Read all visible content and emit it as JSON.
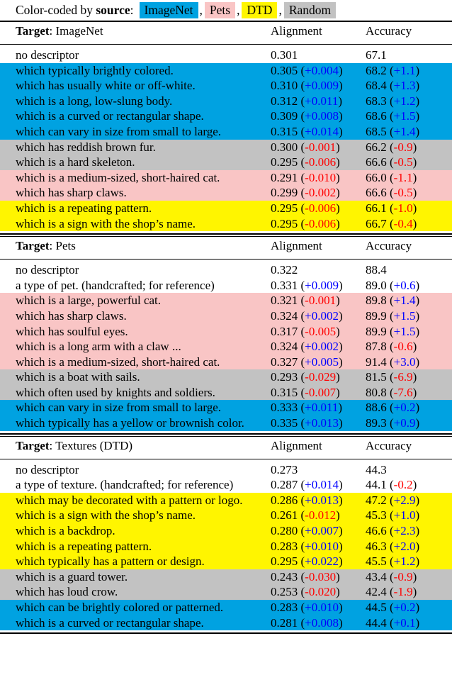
{
  "legend": {
    "prefix_before_bold": "Color-coded by ",
    "bold_word": "source",
    "colon": ":",
    "chips": [
      {
        "label": "ImageNet",
        "color": "#00A2E1"
      },
      {
        "label": "Pets",
        "color": "#F9C5C5"
      },
      {
        "label": "DTD",
        "color": "#FFF500"
      },
      {
        "label": "Random",
        "color": "#C2C2C2"
      }
    ],
    "separator": ","
  },
  "colors": {
    "imagenet": "#00A2E1",
    "pets": "#F9C5C5",
    "dtd": "#FFF500",
    "random": "#C2C2C2",
    "delta_positive": "#0000FF",
    "delta_negative": "#FF0000"
  },
  "columns": {
    "descriptor": "",
    "alignment": "Alignment",
    "accuracy": "Accuracy"
  },
  "sections": [
    {
      "target_label": "Target",
      "target_name": "ImageNet",
      "rows": [
        {
          "desc": "no descriptor",
          "align": "0.301",
          "align_delta": "",
          "align_sign": "",
          "acc": "67.1",
          "acc_delta": "",
          "acc_sign": "",
          "source": "none"
        },
        {
          "desc": "which typically brightly colored.",
          "align": "0.305",
          "align_delta": "+0.004",
          "align_sign": "pos",
          "acc": "68.2",
          "acc_delta": "+1.1",
          "acc_sign": "pos",
          "source": "imagenet"
        },
        {
          "desc": "which has usually white or off-white.",
          "align": "0.310",
          "align_delta": "+0.009",
          "align_sign": "pos",
          "acc": "68.4",
          "acc_delta": "+1.3",
          "acc_sign": "pos",
          "source": "imagenet"
        },
        {
          "desc": "which is a long, low-slung body.",
          "align": "0.312",
          "align_delta": "+0.011",
          "align_sign": "pos",
          "acc": "68.3",
          "acc_delta": "+1.2",
          "acc_sign": "pos",
          "source": "imagenet"
        },
        {
          "desc": "which is a curved or rectangular shape.",
          "align": "0.309",
          "align_delta": "+0.008",
          "align_sign": "pos",
          "acc": "68.6",
          "acc_delta": "+1.5",
          "acc_sign": "pos",
          "source": "imagenet"
        },
        {
          "desc": "which can vary in size from small to large.",
          "align": "0.315",
          "align_delta": "+0.014",
          "align_sign": "pos",
          "acc": "68.5",
          "acc_delta": "+1.4",
          "acc_sign": "pos",
          "source": "imagenet"
        },
        {
          "desc": "which has reddish brown fur.",
          "align": "0.300",
          "align_delta": "-0.001",
          "align_sign": "neg",
          "acc": "66.2",
          "acc_delta": "-0.9",
          "acc_sign": "neg",
          "source": "random"
        },
        {
          "desc": "which is a hard skeleton.",
          "align": "0.295",
          "align_delta": "-0.006",
          "align_sign": "neg",
          "acc": "66.6",
          "acc_delta": "-0.5",
          "acc_sign": "neg",
          "source": "random"
        },
        {
          "desc": "which is a medium-sized, short-haired cat.",
          "align": "0.291",
          "align_delta": "-0.010",
          "align_sign": "neg",
          "acc": "66.0",
          "acc_delta": "-1.1",
          "acc_sign": "neg",
          "source": "pets"
        },
        {
          "desc": "which has sharp claws.",
          "align": "0.299",
          "align_delta": "-0.002",
          "align_sign": "neg",
          "acc": "66.6",
          "acc_delta": "-0.5",
          "acc_sign": "neg",
          "source": "pets"
        },
        {
          "desc": "which is a repeating pattern.",
          "align": "0.295",
          "align_delta": "-0.006",
          "align_sign": "neg",
          "acc": "66.1",
          "acc_delta": "-1.0",
          "acc_sign": "neg",
          "source": "dtd"
        },
        {
          "desc": "which is a sign with the shop’s name.",
          "align": "0.295",
          "align_delta": "-0.006",
          "align_sign": "neg",
          "acc": "66.7",
          "acc_delta": "-0.4",
          "acc_sign": "neg",
          "source": "dtd"
        }
      ]
    },
    {
      "target_label": "Target",
      "target_name": "Pets",
      "rows": [
        {
          "desc": "no descriptor",
          "align": "0.322",
          "align_delta": "",
          "align_sign": "",
          "acc": "88.4",
          "acc_delta": "",
          "acc_sign": "",
          "source": "none"
        },
        {
          "desc": "a type of pet. (handcrafted; for reference)",
          "align": "0.331",
          "align_delta": "+0.009",
          "align_sign": "pos",
          "acc": "89.0",
          "acc_delta": "+0.6",
          "acc_sign": "pos",
          "source": "none"
        },
        {
          "desc": "which is a large, powerful cat.",
          "align": "0.321",
          "align_delta": "-0.001",
          "align_sign": "neg",
          "acc": "89.8",
          "acc_delta": "+1.4",
          "acc_sign": "pos",
          "source": "pets"
        },
        {
          "desc": "which has sharp claws.",
          "align": "0.324",
          "align_delta": "+0.002",
          "align_sign": "pos",
          "acc": "89.9",
          "acc_delta": "+1.5",
          "acc_sign": "pos",
          "source": "pets"
        },
        {
          "desc": "which has soulful eyes.",
          "align": "0.317",
          "align_delta": "-0.005",
          "align_sign": "neg",
          "acc": "89.9",
          "acc_delta": "+1.5",
          "acc_sign": "pos",
          "source": "pets"
        },
        {
          "desc": "which is a long arm with a claw ...",
          "align": "0.324",
          "align_delta": "+0.002",
          "align_sign": "pos",
          "acc": "87.8",
          "acc_delta": "-0.6",
          "acc_sign": "neg",
          "source": "pets"
        },
        {
          "desc": "which is a medium-sized, short-haired cat.",
          "align": "0.327",
          "align_delta": "+0.005",
          "align_sign": "pos",
          "acc": "91.4",
          "acc_delta": "+3.0",
          "acc_sign": "pos",
          "source": "pets"
        },
        {
          "desc": "which is a boat with sails.",
          "align": "0.293",
          "align_delta": "-0.029",
          "align_sign": "neg",
          "acc": "81.5",
          "acc_delta": "-6.9",
          "acc_sign": "neg",
          "source": "random"
        },
        {
          "desc": "which often used by knights and soldiers.",
          "align": "0.315",
          "align_delta": "-0.007",
          "align_sign": "neg",
          "acc": "80.8",
          "acc_delta": "-7.6",
          "acc_sign": "neg",
          "source": "random"
        },
        {
          "desc": "which can vary in size from small to large.",
          "align": "0.333",
          "align_delta": "+0.011",
          "align_sign": "pos",
          "acc": "88.6",
          "acc_delta": "+0.2",
          "acc_sign": "pos",
          "source": "imagenet"
        },
        {
          "desc": "which typically has a yellow or brownish color.",
          "align": "0.335",
          "align_delta": "+0.013",
          "align_sign": "pos",
          "acc": "89.3",
          "acc_delta": "+0.9",
          "acc_sign": "pos",
          "source": "imagenet"
        }
      ]
    },
    {
      "target_label": "Target",
      "target_name": "Textures (DTD)",
      "rows": [
        {
          "desc": "no descriptor",
          "align": "0.273",
          "align_delta": "",
          "align_sign": "",
          "acc": "44.3",
          "acc_delta": "",
          "acc_sign": "",
          "source": "none"
        },
        {
          "desc": "a type of texture. (handcrafted; for reference)",
          "align": "0.287",
          "align_delta": "+0.014",
          "align_sign": "pos",
          "acc": "44.1",
          "acc_delta": "-0.2",
          "acc_sign": "neg",
          "source": "none"
        },
        {
          "desc": "which may be decorated with a pattern or logo.",
          "align": "0.286",
          "align_delta": "+0.013",
          "align_sign": "pos",
          "acc": "47.2",
          "acc_delta": "+2.9",
          "acc_sign": "pos",
          "source": "dtd"
        },
        {
          "desc": "which is a sign with the shop’s name.",
          "align": "0.261",
          "align_delta": "-0.012",
          "align_sign": "neg",
          "acc": "45.3",
          "acc_delta": "+1.0",
          "acc_sign": "pos",
          "source": "dtd"
        },
        {
          "desc": "which is a backdrop.",
          "align": "0.280",
          "align_delta": "+0.007",
          "align_sign": "pos",
          "acc": "46.6",
          "acc_delta": "+2.3",
          "acc_sign": "pos",
          "source": "dtd"
        },
        {
          "desc": "which is a repeating pattern.",
          "align": "0.283",
          "align_delta": "+0.010",
          "align_sign": "pos",
          "acc": "46.3",
          "acc_delta": "+2.0",
          "acc_sign": "pos",
          "source": "dtd"
        },
        {
          "desc": "which typically has a pattern or design.",
          "align": "0.295",
          "align_delta": "+0.022",
          "align_sign": "pos",
          "acc": "45.5",
          "acc_delta": "+1.2",
          "acc_sign": "pos",
          "source": "dtd"
        },
        {
          "desc": "which is a guard tower.",
          "align": "0.243",
          "align_delta": "-0.030",
          "align_sign": "neg",
          "acc": "43.4",
          "acc_delta": "-0.9",
          "acc_sign": "neg",
          "source": "random"
        },
        {
          "desc": "which has loud crow.",
          "align": "0.253",
          "align_delta": "-0.020",
          "align_sign": "neg",
          "acc": "42.4",
          "acc_delta": "-1.9",
          "acc_sign": "neg",
          "source": "random"
        },
        {
          "desc": "which can be brightly colored or patterned.",
          "align": "0.283",
          "align_delta": "+0.010",
          "align_sign": "pos",
          "acc": "44.5",
          "acc_delta": "+0.2",
          "acc_sign": "pos",
          "source": "imagenet"
        },
        {
          "desc": "which is a curved or rectangular shape.",
          "align": "0.281",
          "align_delta": "+0.008",
          "align_sign": "pos",
          "acc": "44.4",
          "acc_delta": "+0.1",
          "acc_sign": "pos",
          "source": "imagenet"
        }
      ]
    }
  ]
}
